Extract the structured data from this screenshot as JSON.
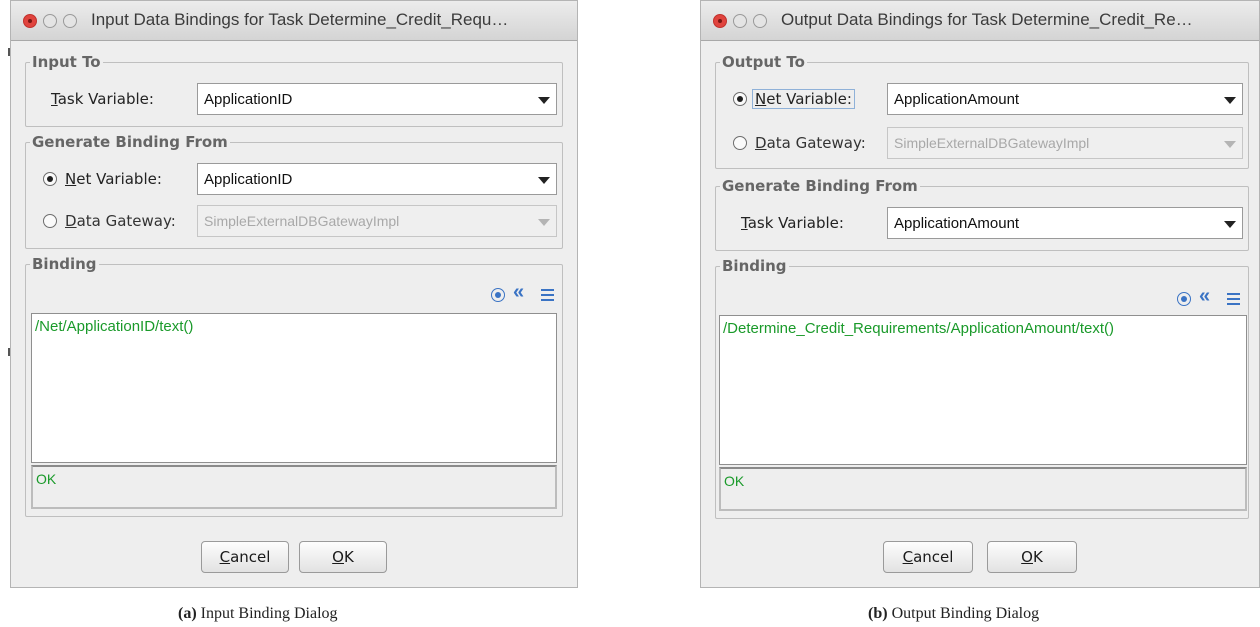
{
  "dialog_a": {
    "title": "Input Data Bindings for Task Determine_Credit_Requ…",
    "group1": {
      "legend": "Input To",
      "task_variable": {
        "mnemonic": "T",
        "label_rest": "ask Variable:",
        "value": "ApplicationID"
      }
    },
    "group2": {
      "legend": "Generate Binding From",
      "net_variable": {
        "mnemonic": "N",
        "label_rest": "et Variable:",
        "value": "ApplicationID",
        "selected": true
      },
      "data_gateway": {
        "mnemonic": "D",
        "label_rest": "ata Gateway:",
        "value": "SimpleExternalDBGatewayImpl",
        "selected": false
      }
    },
    "binding": {
      "legend": "Binding",
      "expression": "/Net/ApplicationID/text()",
      "status": "OK"
    },
    "buttons": {
      "cancel": {
        "mnemonic": "C",
        "rest": "ancel"
      },
      "ok": {
        "mnemonic": "O",
        "rest": "K"
      }
    }
  },
  "dialog_b": {
    "title": "Output Data Bindings for Task Determine_Credit_Re…",
    "group1": {
      "legend": "Output To",
      "net_variable": {
        "mnemonic": "N",
        "label_rest": "et Variable:",
        "value": "ApplicationAmount",
        "selected": true
      },
      "data_gateway": {
        "mnemonic": "D",
        "label_rest": "ata Gateway:",
        "value": "SimpleExternalDBGatewayImpl",
        "selected": false
      }
    },
    "group2": {
      "legend": "Generate Binding From",
      "task_variable": {
        "mnemonic": "T",
        "label_rest": "ask Variable:",
        "value": "ApplicationAmount"
      }
    },
    "binding": {
      "legend": "Binding",
      "expression": "/Determine_Credit_Requirements/ApplicationAmount/text()",
      "status": "OK"
    },
    "buttons": {
      "cancel": {
        "mnemonic": "C",
        "rest": "ancel"
      },
      "ok": {
        "mnemonic": "O",
        "rest": "K"
      }
    }
  },
  "captions": {
    "a": {
      "tag": "(a)",
      "text": " Input Binding Dialog"
    },
    "b": {
      "tag": "(b)",
      "text": " Output Binding Dialog"
    }
  },
  "colors": {
    "binding_text": "#1a9a2a",
    "tool_icon": "#3a73c4",
    "close_button": "#e0443e"
  },
  "icons": {
    "tool1": "target-icon",
    "tool2": "double-chevron-left-icon",
    "tool3": "align-lines-icon",
    "combo_arrow": "chevron-down-icon",
    "tool2_glyph": "«"
  }
}
